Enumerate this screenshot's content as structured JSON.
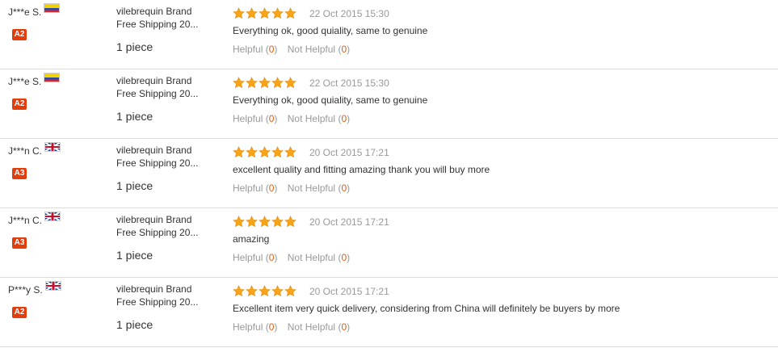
{
  "colors": {
    "badge": "#e23d0b",
    "star": "#f7a41d",
    "count": "#e25d0d",
    "muted": "#999999",
    "divider": "#dcdcdc"
  },
  "reviews": [
    {
      "buyer": "J***e S.",
      "flag_icon": "colombia-flag-icon",
      "level": "A2",
      "product_title": "vilebrequin Brand",
      "product_subtitle": "Free Shipping 20...",
      "quantity": "1 piece",
      "rating": 5,
      "date": "22 Oct 2015 15:30",
      "text": "Everything ok, good quiality, same to genuine",
      "helpful_label": "Helpful",
      "helpful_count": "0",
      "not_helpful_label": "Not Helpful",
      "not_helpful_count": "0"
    },
    {
      "buyer": "J***e S.",
      "flag_icon": "colombia-flag-icon",
      "level": "A2",
      "product_title": "vilebrequin Brand",
      "product_subtitle": "Free Shipping 20...",
      "quantity": "1 piece",
      "rating": 5,
      "date": "22 Oct 2015 15:30",
      "text": "Everything ok, good quiality, same to genuine",
      "helpful_label": "Helpful",
      "helpful_count": "0",
      "not_helpful_label": "Not Helpful",
      "not_helpful_count": "0"
    },
    {
      "buyer": "J***n C.",
      "flag_icon": "uk-flag-icon",
      "level": "A3",
      "product_title": "vilebrequin Brand",
      "product_subtitle": "Free Shipping 20...",
      "quantity": "1 piece",
      "rating": 5,
      "date": "20 Oct 2015 17:21",
      "text": "excellent quality and fitting amazing thank you will buy more",
      "helpful_label": "Helpful",
      "helpful_count": "0",
      "not_helpful_label": "Not Helpful",
      "not_helpful_count": "0"
    },
    {
      "buyer": "J***n C.",
      "flag_icon": "uk-flag-icon",
      "level": "A3",
      "product_title": "vilebrequin Brand",
      "product_subtitle": "Free Shipping 20...",
      "quantity": "1 piece",
      "rating": 5,
      "date": "20 Oct 2015 17:21",
      "text": "amazing",
      "helpful_label": "Helpful",
      "helpful_count": "0",
      "not_helpful_label": "Not Helpful",
      "not_helpful_count": "0"
    },
    {
      "buyer": "P***y S.",
      "flag_icon": "uk-flag-icon",
      "level": "A2",
      "product_title": "vilebrequin Brand",
      "product_subtitle": "Free Shipping 20...",
      "quantity": "1 piece",
      "rating": 5,
      "date": "20 Oct 2015 17:21",
      "text": "Excellent item very quick delivery, considering from China will definitely be buyers by more",
      "helpful_label": "Helpful",
      "helpful_count": "0",
      "not_helpful_label": "Not Helpful",
      "not_helpful_count": "0"
    }
  ]
}
